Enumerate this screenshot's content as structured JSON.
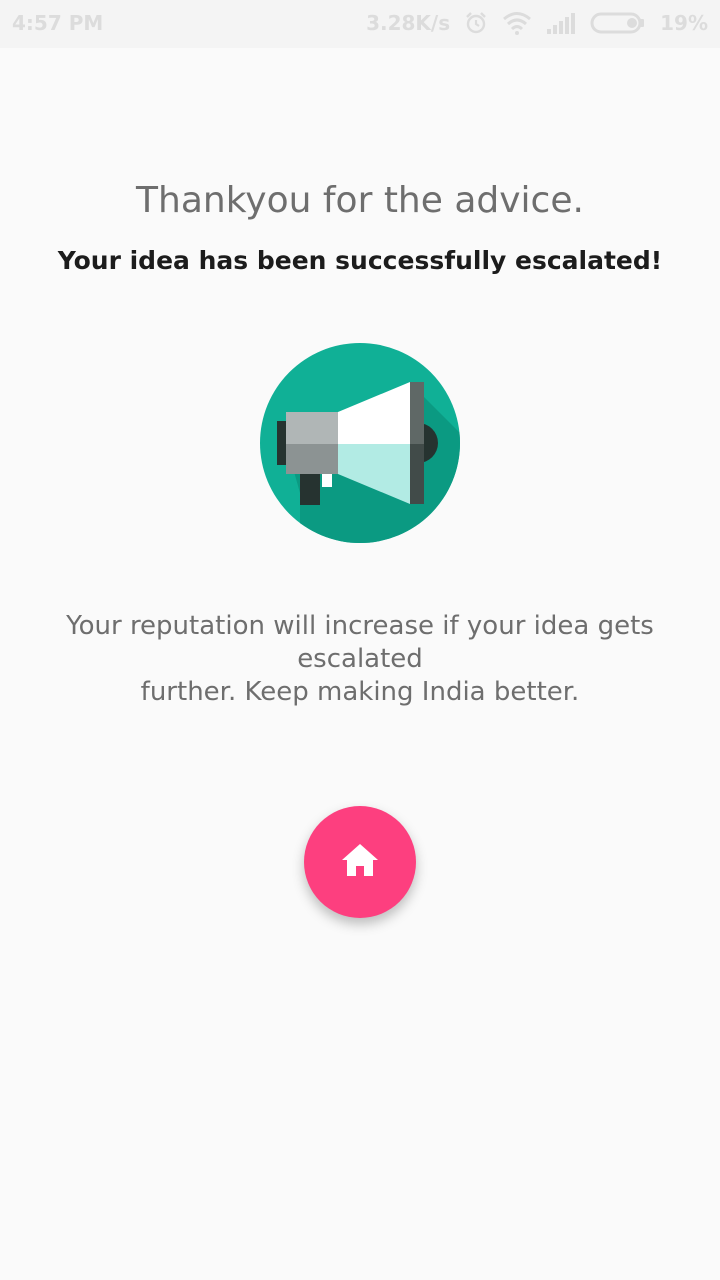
{
  "status_bar": {
    "time": "4:57 PM",
    "network_speed": "3.28K/s",
    "battery_percent": "19%",
    "icons": [
      "alarm-icon",
      "wifi-icon",
      "signal-icon",
      "battery-icon"
    ]
  },
  "confirmation": {
    "title": "Thankyou for the advice.",
    "subtitle": "Your idea has been successfully escalated!",
    "illustration_icon": "megaphone-icon",
    "message_line1": "Your reputation will increase if your idea gets escalated",
    "message_line2": "further. Keep making India better."
  },
  "home_button": {
    "icon": "home-icon",
    "color": "#fd3f7f"
  },
  "colors": {
    "background": "#fafafa",
    "illustration_circle": "#10b096",
    "illustration_shadow": "#0b9a82",
    "accent": "#fd3f7f"
  }
}
